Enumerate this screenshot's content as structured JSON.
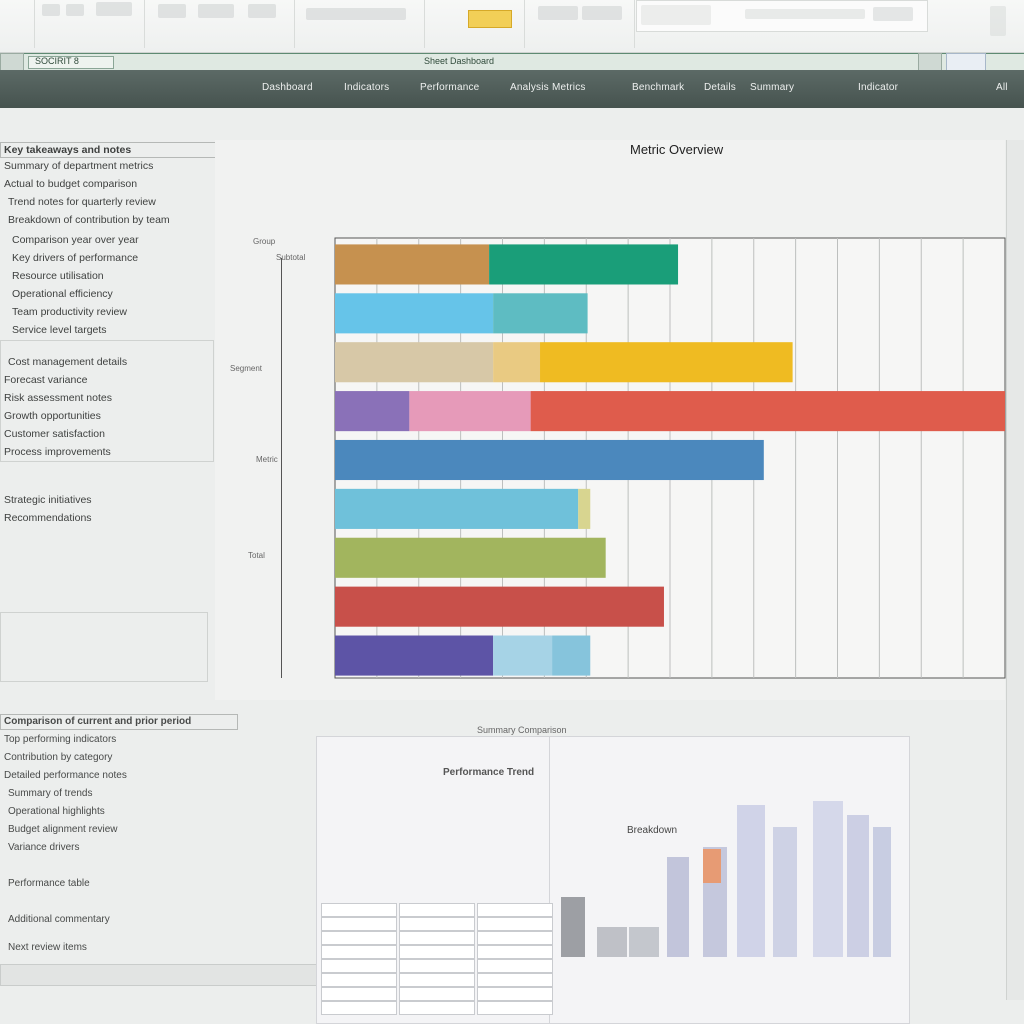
{
  "chart_data": {
    "type": "bar",
    "orientation": "horizontal",
    "stacked": true,
    "title": "Metric Overview",
    "grid": true,
    "xlim": [
      0,
      100
    ],
    "x_tick_count": 16,
    "rows": [
      {
        "segments": [
          {
            "value": 23.0,
            "color": "#c6914f"
          },
          {
            "value": 28.2,
            "color": "#1a9e79"
          }
        ]
      },
      {
        "segments": [
          {
            "value": 23.6,
            "color": "#66c4e9"
          },
          {
            "value": 14.1,
            "color": "#5ebcc2"
          }
        ]
      },
      {
        "segments": [
          {
            "value": 23.6,
            "color": "#d7c8a7"
          },
          {
            "value": 7.0,
            "color": "#e9ca82"
          },
          {
            "value": 37.7,
            "color": "#efbb22"
          }
        ]
      },
      {
        "segments": [
          {
            "value": 11.1,
            "color": "#8a71b8"
          },
          {
            "value": 18.1,
            "color": "#e69ab9"
          },
          {
            "value": 70.8,
            "color": "#df5c4c"
          }
        ]
      },
      {
        "segments": [
          {
            "value": 64.0,
            "color": "#4b88bd"
          }
        ]
      },
      {
        "segments": [
          {
            "value": 36.3,
            "color": "#6fc1da"
          },
          {
            "value": 1.8,
            "color": "#d8d590"
          }
        ]
      },
      {
        "segments": [
          {
            "value": 40.4,
            "color": "#a2b55e"
          }
        ]
      },
      {
        "segments": [
          {
            "value": 49.1,
            "color": "#c8504a"
          }
        ]
      },
      {
        "segments": [
          {
            "value": 23.6,
            "color": "#5d54a6"
          },
          {
            "value": 8.8,
            "color": "#a6d3e6"
          },
          {
            "value": 5.7,
            "color": "#86c4dc"
          }
        ]
      }
    ]
  },
  "ui": {
    "formula_name_box": "SOCIRIT 8",
    "formula_text": "Sheet Dashboard",
    "header_tabs": [
      "Dashboard",
      "Indicators",
      "Performance",
      "Analysis",
      "Metrics",
      "Benchmark",
      "Details",
      "Summary",
      "Indicator",
      "All"
    ],
    "left_panel_title": "Key takeaways and notes",
    "left_panel_items": [
      "Summary of department metrics",
      "Actual to budget comparison",
      "Trend notes for quarterly review",
      "Breakdown of contribution by team",
      "Comparison year over year",
      "Key drivers of performance",
      "Resource utilisation",
      "Operational efficiency",
      "Team productivity review",
      "Service level targets",
      "Cost management details",
      "Forecast variance",
      "Risk assessment notes",
      "Growth opportunities",
      "Customer satisfaction",
      "Process improvements",
      "Strategic initiatives",
      "Recommendations"
    ],
    "chart_side_labels": [
      "Group",
      "Subtotal",
      "Segment",
      "Metric",
      "Total"
    ],
    "bottom_panel_title": "Summary Comparison",
    "bottom_labels": [
      "Performance Trend",
      "Breakdown"
    ],
    "bottom_list": [
      "Comparison of current and prior period",
      "Top performing indicators",
      "Contribution by category",
      "Detailed performance notes",
      "Summary of trends",
      "Operational highlights",
      "Budget alignment review",
      "Variance drivers",
      "Performance table",
      "Additional commentary",
      "Next review items"
    ]
  },
  "colors": {
    "header_bg": "#4f5c58",
    "formula_bar": "#dfe9e2",
    "page_bg": "#eceeed"
  }
}
